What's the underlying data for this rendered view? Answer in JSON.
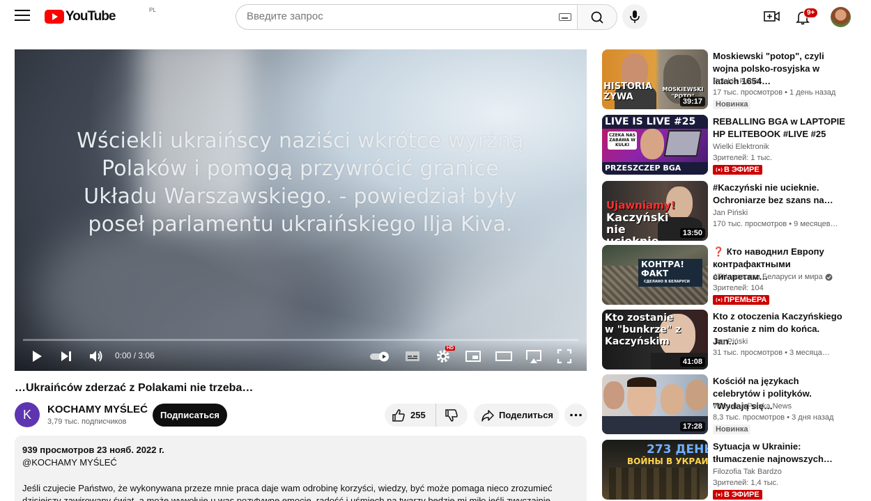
{
  "header": {
    "logo_text": "YouTube",
    "country_code": "PL",
    "search_placeholder": "Введите запрос",
    "notifications_badge": "9+"
  },
  "player": {
    "overlay_text": "Wściekli ukraińscy naziści wkrótce wyrżną Polaków i pomogą przywrócić granice Układu Warszawskiego. - powiedział były poseł parlamentu ukraińskiego Ilja Kiva.",
    "time": "0:00 / 3:06",
    "progress_fraction": 0.0,
    "quality_badge": "HD"
  },
  "video": {
    "title": "…Ukraińców zderzać z Polakami nie trzeba…",
    "channel_initial": "K",
    "channel_name": "KOCHAMY MYŚLEĆ",
    "subscribers": "3,79 тыс. подписчиков",
    "subscribe_label": "Подписаться",
    "likes": "255",
    "share_label": "Поделиться"
  },
  "description": {
    "meta": "939 просмотров  23 нояб. 2022 г.",
    "handle": "@KOCHAMY MYŚLEĆ",
    "text": "Jeśli czujecie Państwo, że wykonywana przeze mnie praca daje wam odrobinę korzyści, wiedzy, być może pomaga nieco zrozumieć dzisiejszy zawirowany świat, a może wywołuje u was pozytywne emocje, radość i uśmiech na twarzy będzie mi miło jeśli zwyczajnie poczęstujecie mnie"
  },
  "recommendations": [
    {
      "title": "Moskiewski \"potop\", czyli wojna polsko-rosyjska w latach 1654…",
      "channel": "Polskie Radio",
      "stats": "17 тыс. просмотров • 1 день назад",
      "duration": "39:17",
      "badge": "Новинка",
      "badge_type": "new",
      "thumb_text": "HISTORIA ŻYWA",
      "thumb_text2": "MOSKIEWSKI \"POTO\""
    },
    {
      "title": "REBALLING BGA w LAPTOPIE HP ELITEBOOK #LIVE #25",
      "channel": "Wielki Elektronik",
      "stats": "Зрителей: 1 тыс.",
      "duration": "",
      "badge": "В ЭФИРЕ",
      "badge_type": "live",
      "thumb_text": "LIVE IS LIVE #25",
      "thumb_text2": "PRZESZCZEP BGA",
      "thumb_text3": "CZEKA NAS ZABAWA W KULKI"
    },
    {
      "title": "#Kaczyński nie ucieknie. Ochroniarze bez szans na…",
      "channel": "Jan Piński",
      "stats": "170 тыс. просмотров • 9 месяцев…",
      "duration": "13:50",
      "badge": "",
      "badge_type": "",
      "thumb_text": "Kaczyński nie ucieknie",
      "thumb_text2": "Ujawniamy!"
    },
    {
      "title": "❓ Кто наводнил Европу контрафактными сигаретам…",
      "channel": "АТН: новости Беларуси и мира",
      "stats": "Зрителей: 104",
      "duration": "",
      "badge": "ПРЕМЬЕРА",
      "badge_type": "live",
      "thumb_text": "КОНТРА! ФАКТ",
      "thumb_text2": "СДЕЛАНО В БЕЛАРУСИ"
    },
    {
      "title": "Kto z otoczenia Kaczyńskiego zostanie z nim do końca. Jan…",
      "channel": "Jan Piński",
      "stats": "31 тыс. просмотров • 3 месяца…",
      "duration": "41:08",
      "badge": "",
      "badge_type": "",
      "thumb_text": "Kto zostanie w \"bunkrze\" z Kaczyńskim"
    },
    {
      "title": "Kościół na językach celebrytów i polityków. \"Wydają się…",
      "channel": "Wirtualna Polska News",
      "stats": "8,3 тыс. просмотров • 3 дня назад",
      "duration": "17:28",
      "badge": "Новинка",
      "badge_type": "new"
    },
    {
      "title": "Sytuacja w Ukrainie: tłumaczenie najnowszych…",
      "channel": "Filozofia Tak Bardzo",
      "stats": "Зрителей: 1,4 тыс.",
      "duration": "",
      "badge": "В ЭФИРЕ",
      "badge_type": "live",
      "thumb_text": "273 ДЕНЬ",
      "thumb_text2": "ВОЙНЫ В УКРАИНЕ"
    }
  ]
}
